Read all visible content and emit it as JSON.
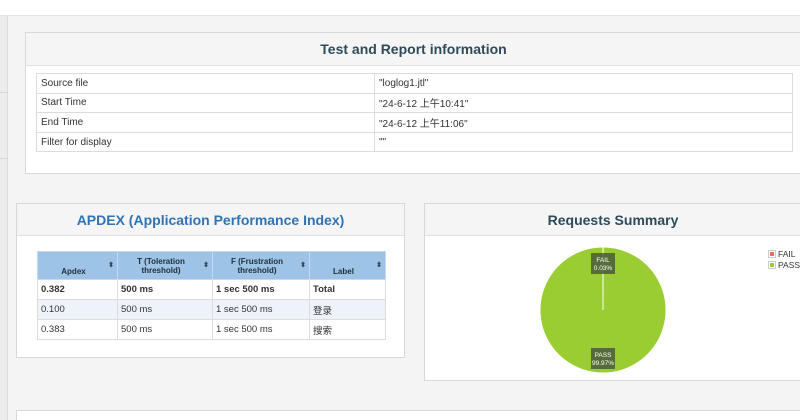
{
  "info": {
    "title": "Test and Report information",
    "rows": [
      {
        "key": "Source file",
        "value": "\"loglog1.jtl\""
      },
      {
        "key": "Start Time",
        "value": "\"24-6-12 上午10:41\""
      },
      {
        "key": "End Time",
        "value": "\"24-6-12 上午11:06\""
      },
      {
        "key": "Filter for display",
        "value": "\"\""
      }
    ]
  },
  "apdex": {
    "title": "APDEX (Application Performance Index)",
    "headers": [
      "Apdex",
      "T (Toleration threshold)",
      "F (Frustration threshold)",
      "Label"
    ],
    "sort_icon": "⬍",
    "rows": [
      [
        "0.382",
        "500 ms",
        "1 sec 500 ms",
        "Total"
      ],
      [
        "0.100",
        "500 ms",
        "1 sec 500 ms",
        "登录"
      ],
      [
        "0.383",
        "500 ms",
        "1 sec 500 ms",
        "搜索"
      ]
    ]
  },
  "summary": {
    "title": "Requests Summary",
    "legend": [
      {
        "label": "FAIL",
        "color": "#f26c5b"
      },
      {
        "label": "PASS",
        "color": "#9acd32"
      }
    ],
    "slices": [
      {
        "label": "FAIL",
        "value": 0.03,
        "text": "0.03%",
        "color": "#f26c5b"
      },
      {
        "label": "PASS",
        "value": 99.97,
        "text": "99.97%",
        "color": "#9acd32"
      }
    ]
  },
  "colors": {
    "pass": "#9acd32",
    "fail": "#f26c5b",
    "apdex_header": "#9dc3e6",
    "apdex_title": "#2e74b5"
  }
}
